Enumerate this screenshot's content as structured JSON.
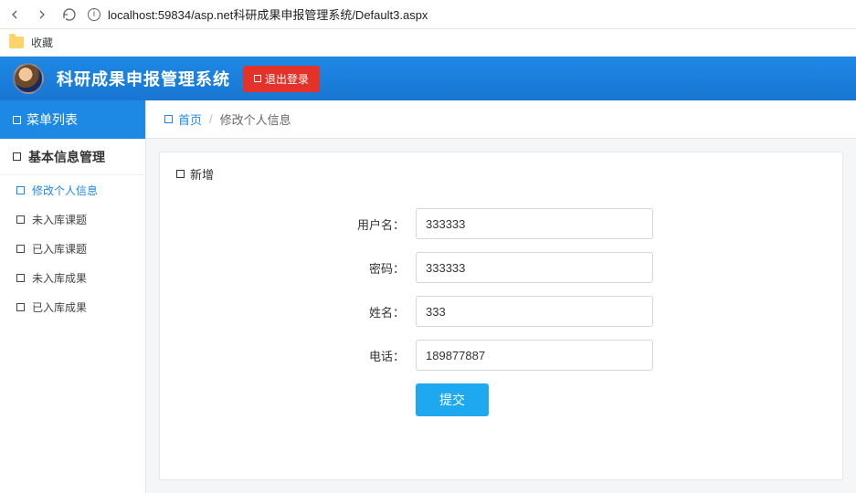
{
  "browser": {
    "url": "localhost:59834/asp.net科研成果申报管理系统/Default3.aspx"
  },
  "bookmarks": {
    "fav_label": "收藏"
  },
  "header": {
    "title": "科研成果申报管理系统",
    "logout_label": "退出登录"
  },
  "sidebar": {
    "menu_header": "菜单列表",
    "section_label": "基本信息管理",
    "items": [
      {
        "label": "修改个人信息",
        "active": true
      },
      {
        "label": "未入库课题",
        "active": false
      },
      {
        "label": "已入库课题",
        "active": false
      },
      {
        "label": "未入库成果",
        "active": false
      },
      {
        "label": "已入库成果",
        "active": false
      }
    ]
  },
  "breadcrumb": {
    "home_label": "首页",
    "current_label": "修改个人信息"
  },
  "panel": {
    "title": "新增"
  },
  "form": {
    "username_label": "用户名：",
    "username_value": "333333",
    "password_label": "密码：",
    "password_value": "333333",
    "name_label": "姓名：",
    "name_value": "333",
    "phone_label": "电话：",
    "phone_value": "189877887",
    "submit_label": "提交"
  }
}
